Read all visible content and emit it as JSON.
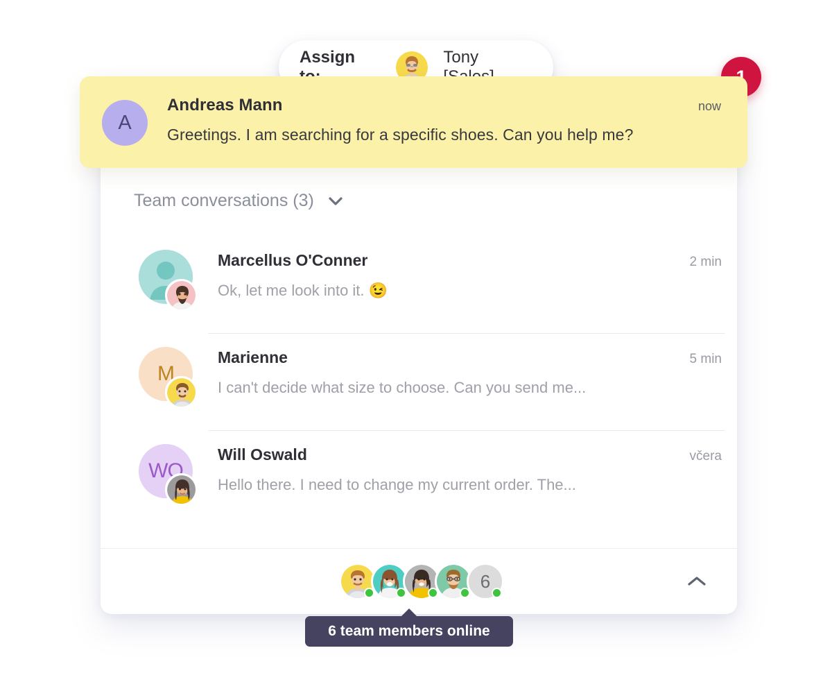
{
  "assign_pill": {
    "label": "Assign to:",
    "agent_name": "Tony [Sales]",
    "avatar_name": "tony-sales-avatar"
  },
  "badge": {
    "count": "1",
    "color": "#d01440"
  },
  "new_message": {
    "avatar_initial": "A",
    "avatar_bg": "#b7aeee",
    "sender": "Andreas Mann",
    "time": "now",
    "text": "Greetings. I am searching for a specific shoes. Can you help me?",
    "background": "#fbf1a8"
  },
  "conversations_header": {
    "title": "Team conversations (3)",
    "chevron": "chevron-down-icon"
  },
  "conversations": [
    {
      "name": "Marcellus O'Conner",
      "time": "2 min",
      "preview": "Ok, let me look into it.",
      "emoji": "😉",
      "avatar_initials": "",
      "avatar_bg": "#9fdbd8",
      "avatar_fg": "#6cc4bf",
      "avatar_type": "silhouette"
    },
    {
      "name": "Marienne",
      "time": "5 min",
      "preview": "I can't decide what size to choose. Can you send me...",
      "emoji": "",
      "avatar_initials": "M",
      "avatar_bg": "#fadfc7",
      "avatar_fg": "#bd8420",
      "avatar_type": "initials"
    },
    {
      "name": "Will Oswald",
      "time": "včera",
      "preview": "Hello there. I need to change my current order. The...",
      "emoji": "",
      "avatar_initials": "WO",
      "avatar_bg": "#e4d1f5",
      "avatar_fg": "#9b59c9",
      "avatar_type": "initials"
    }
  ],
  "footer": {
    "members": [
      {
        "name": "member-avatar-1",
        "online": true
      },
      {
        "name": "member-avatar-2",
        "online": true
      },
      {
        "name": "member-avatar-3",
        "online": true
      },
      {
        "name": "member-avatar-4",
        "online": true
      }
    ],
    "overflow_count": "6",
    "collapse_icon": "chevron-up-icon",
    "online_dot_color": "#3ec43e"
  },
  "tooltip": {
    "text": "6 team members online",
    "background": "#454360"
  }
}
